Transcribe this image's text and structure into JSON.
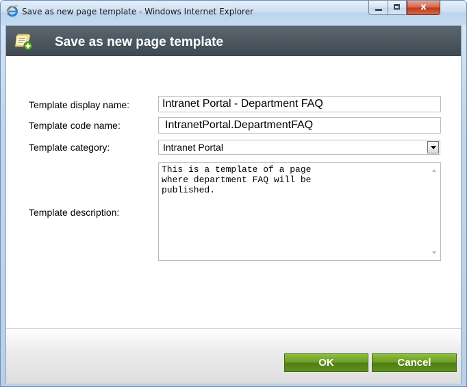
{
  "window": {
    "title": "Save as new page template - Windows Internet Explorer",
    "icons": {
      "browser": "internet-explorer-icon",
      "minimize": "minimize-icon",
      "maximize": "maximize-icon",
      "close": "close-icon"
    },
    "close_glyph": "x"
  },
  "dialog": {
    "title": "Save as new page template",
    "header_icon": "page-template-add-icon",
    "fields": {
      "display_name_label": "Template display name:",
      "display_name_value": "Intranet Portal - Department FAQ",
      "code_name_label": "Template code name:",
      "code_name_value": "IntranetPortal.DepartmentFAQ",
      "category_label": "Template category:",
      "category_value": "Intranet Portal",
      "description_label": "Template description:",
      "description_value": "This is a template of a page\nwhere department FAQ will be\npublished."
    },
    "buttons": {
      "ok": "OK",
      "cancel": "Cancel"
    }
  },
  "colors": {
    "header_bg": "#4b555e",
    "button_green": "#6a9a22",
    "close_red": "#c0391c"
  }
}
